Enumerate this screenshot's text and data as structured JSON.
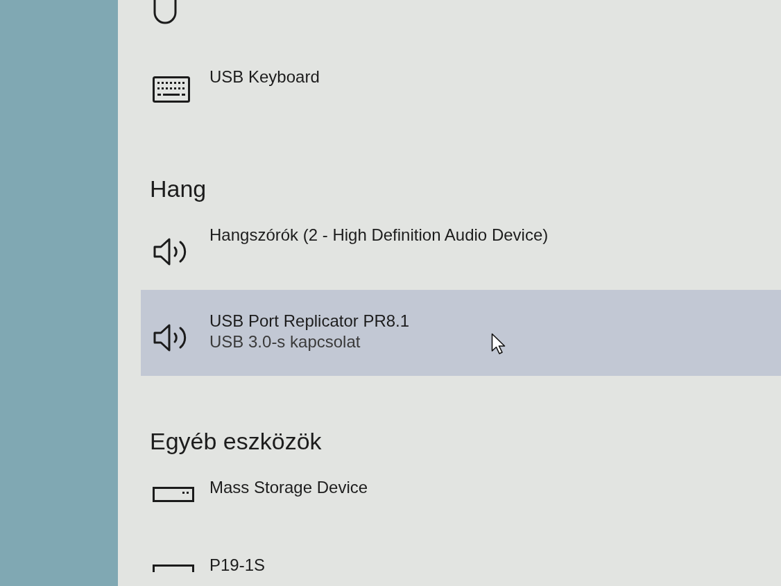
{
  "sections": [
    {
      "devices": [
        {
          "kind": "mouse",
          "selected": false
        },
        {
          "kind": "keyboard",
          "name": "USB Keyboard",
          "selected": false
        }
      ]
    },
    {
      "heading": "Hang",
      "devices": [
        {
          "kind": "speaker",
          "name": "Hangszórók (2 - High Definition Audio Device)",
          "selected": false
        },
        {
          "kind": "speaker",
          "name": "USB Port Replicator PR8.1",
          "status": "USB 3.0-s kapcsolat",
          "selected": true
        }
      ]
    },
    {
      "heading": "Egyéb eszközök",
      "devices": [
        {
          "kind": "storage",
          "name": "Mass Storage Device",
          "selected": false
        },
        {
          "kind": "monitor",
          "name": "P19-1S",
          "selected": false
        }
      ]
    }
  ]
}
